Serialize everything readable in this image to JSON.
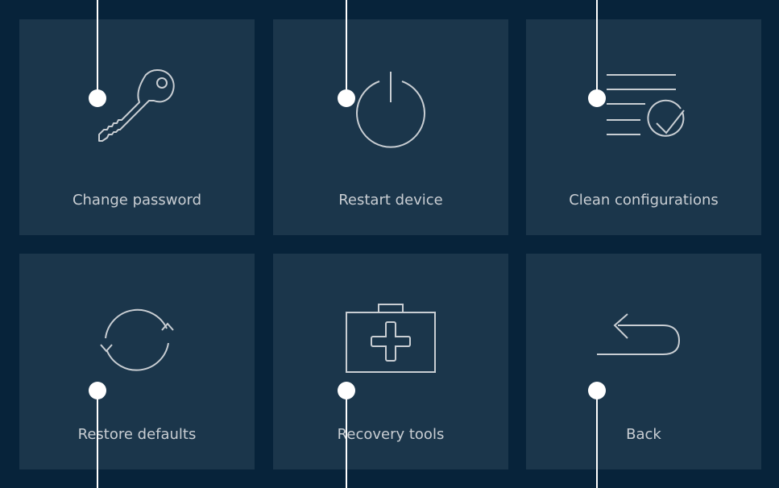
{
  "colors": {
    "background": "#07233a",
    "tile": "#1b364b",
    "text": "#c9ced3",
    "icon_stroke": "#c9ced3",
    "callout": "#ffffff"
  },
  "menu": {
    "items": [
      {
        "label": "Change password",
        "icon": "key-icon"
      },
      {
        "label": "Restart device",
        "icon": "power-icon"
      },
      {
        "label": "Clean configurations",
        "icon": "clean-config-icon"
      },
      {
        "label": "Restore defaults",
        "icon": "refresh-icon"
      },
      {
        "label": "Recovery tools",
        "icon": "first-aid-kit-icon"
      },
      {
        "label": "Back",
        "icon": "back-arrow-icon"
      }
    ]
  }
}
